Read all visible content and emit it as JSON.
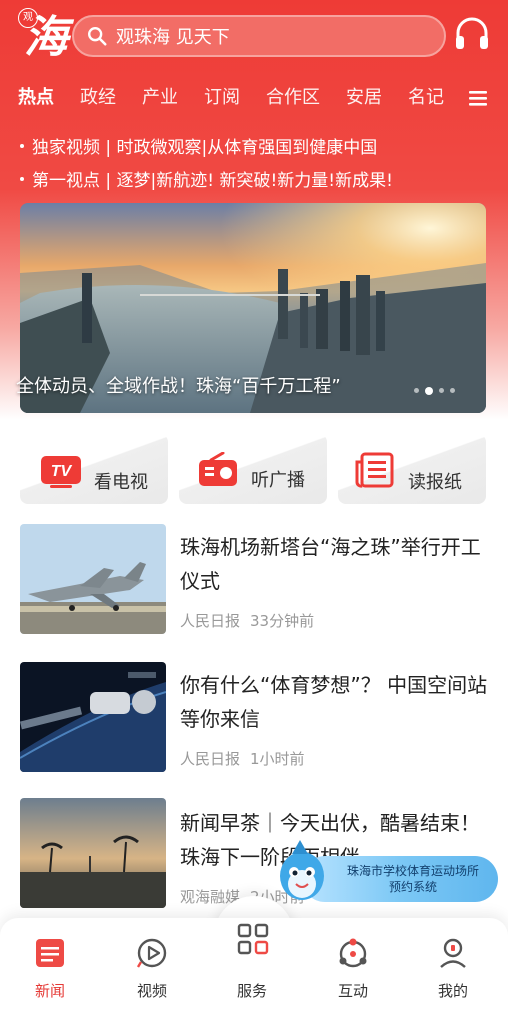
{
  "header": {
    "logo_badge": "观",
    "logo_char": "海",
    "search_text": "观珠海 见天下"
  },
  "tabs": [
    "热点",
    "政经",
    "产业",
    "订阅",
    "合作区",
    "安居",
    "名记"
  ],
  "ticker": [
    "独家视频 | 时政微观察|从体育强国到健康中国",
    "第一视点 | 逐梦|新航迹! 新突破!新力量!新成果!"
  ],
  "banner": {
    "caption": "全体动员、全域作战！珠海“百千万工程”",
    "dots_total": 4,
    "dots_active": 1
  },
  "quick_links": [
    "看电视",
    "听广播",
    "读报纸"
  ],
  "quick_icon_text": {
    "tv": "TV"
  },
  "news": [
    {
      "title": "珠海机场新塔台“海之珠”举行开工仪式",
      "source": "人民日报",
      "time": "33分钟前"
    },
    {
      "title": "你有什么“体育梦想”？ 中国空间站等你来信",
      "source": "人民日报",
      "time": "1小时前"
    },
    {
      "title": "新闻早茶｜今天出伏，酷暑结束！珠海下一阶段雨相伴",
      "source": "观海融媒",
      "time": "2小时前"
    }
  ],
  "promo": {
    "line1": "珠海市学校体育运动场所",
    "line2": "预约系统"
  },
  "bottom_nav": [
    {
      "label": "新闻",
      "active": true
    },
    {
      "label": "视频",
      "active": false
    },
    {
      "label": "服务",
      "active": false
    },
    {
      "label": "互动",
      "active": false
    },
    {
      "label": "我的",
      "active": false
    }
  ],
  "colors": {
    "brand_red": "#ee3b36",
    "active_nav": "#e53935",
    "meta_gray": "#999999"
  },
  "icons": {
    "search": "search-icon",
    "headphones": "headphones-icon",
    "menu": "menu-icon",
    "tv": "tv-icon",
    "radio": "radio-icon",
    "newspaper": "newspaper-icon",
    "news_nav": "news-icon",
    "video_nav": "play-icon",
    "service_nav": "grid-icon",
    "interact_nav": "interact-icon",
    "mine_nav": "user-icon"
  }
}
